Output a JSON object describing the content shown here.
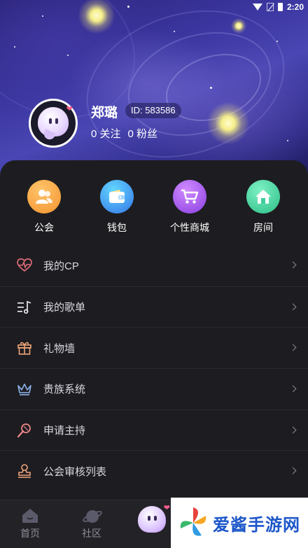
{
  "status_bar": {
    "time": "2:20"
  },
  "profile": {
    "nickname": "郑璐",
    "id_text": "ID: 583586",
    "following": "0 关注",
    "fans": "0 粉丝"
  },
  "quick_actions": [
    {
      "label": "公会",
      "icon": "guild-icon",
      "color": "#f3a13a"
    },
    {
      "label": "钱包",
      "icon": "wallet-icon",
      "color": "#35b6e6"
    },
    {
      "label": "个性商城",
      "icon": "cart-icon",
      "color": "#a24fe6"
    },
    {
      "label": "房间",
      "icon": "home-icon",
      "color": "#3ccf9b"
    }
  ],
  "menu": [
    {
      "label": "我的CP",
      "icon": "heartbeat-icon",
      "icon_color": "#e06a78"
    },
    {
      "label": "我的歌单",
      "icon": "music-list-icon",
      "icon_color": "#e9e6ee"
    },
    {
      "label": "礼物墙",
      "icon": "gift-icon",
      "icon_color": "#f1a57a"
    },
    {
      "label": "贵族系统",
      "icon": "crown-icon",
      "icon_color": "#8fb4ee"
    },
    {
      "label": "申请主持",
      "icon": "microphone-icon",
      "icon_color": "#f08a8a"
    },
    {
      "label": "公会审核列表",
      "icon": "stamp-icon",
      "icon_color": "#f1a57a"
    }
  ],
  "bottom_nav": [
    {
      "label": "首页",
      "icon": "home-tab-icon"
    },
    {
      "label": "社区",
      "icon": "planet-icon"
    }
  ],
  "watermark": {
    "text": "爱酱手游网"
  }
}
